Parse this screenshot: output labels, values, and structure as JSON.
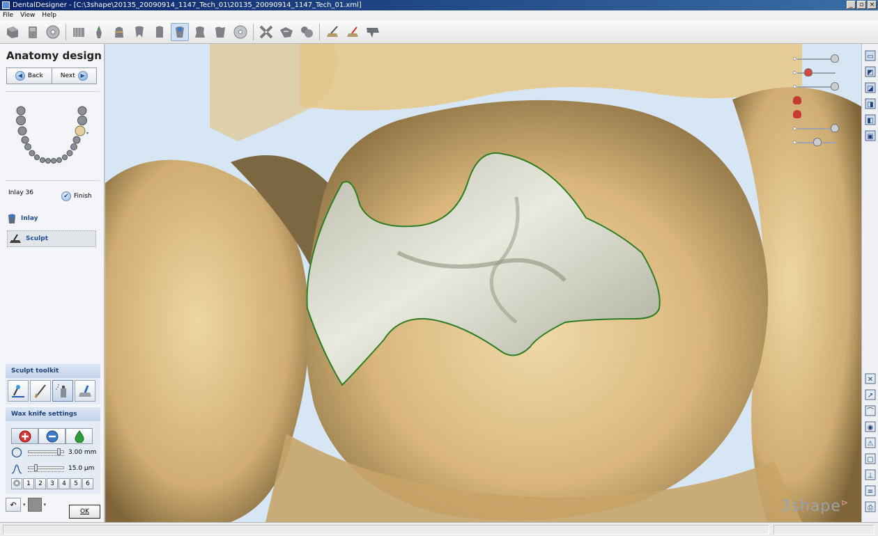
{
  "window": {
    "title": "DentalDesigner - [C:\\3shape\\20135_20090914_1147_Tech_01\\20135_20090914_1147_Tech_01.xml]",
    "minimize": "_",
    "restore": "▫",
    "close": "×"
  },
  "menu": [
    "File",
    "View",
    "Help"
  ],
  "toolbar": {
    "icons": [
      "order-icon",
      "scan-icon",
      "disc-icon",
      "model-icon",
      "margin-icon",
      "die-icon",
      "tooth-icon",
      "abutment-icon",
      "inlay-icon",
      "crown-icon",
      "bridge-icon",
      "cd-icon",
      "connect-icon",
      "connect2-icon",
      "cluster-icon",
      "sculpt-icon",
      "wax-icon",
      "export-icon"
    ],
    "active_index": 8
  },
  "left_panel": {
    "title": "Anatomy design",
    "back_label": "Back",
    "next_label": "Next",
    "tooth_label": "Inlay 36",
    "finish_label": "Finish",
    "steps": [
      {
        "label": "Inlay",
        "icon": "inlay-step-icon"
      },
      {
        "label": "Sculpt",
        "icon": "sculpt-step-icon",
        "active": true
      }
    ],
    "sculpt_toolkit": {
      "title": "Sculpt toolkit",
      "tools": [
        "wax-knife-tool-icon",
        "morph-pen-tool-icon",
        "spray-tool-icon",
        "smooth-tool-icon"
      ],
      "active_index": 2
    },
    "wax_knife": {
      "title": "Wax knife settings",
      "modes": [
        "add-icon",
        "remove-icon",
        "smooth-drop-icon"
      ],
      "active_mode": 0,
      "size_value": "3.00 mm",
      "size_level": 0.9,
      "amount_value": "15.0 µm",
      "amount_level": 0.2,
      "presets": [
        "1",
        "2",
        "3",
        "4",
        "5",
        "6"
      ]
    },
    "ok_label": "OK"
  },
  "viewport": {
    "logo": "3shape",
    "colors": {
      "background": "#d6e6f5",
      "tooth": "#e2c48e",
      "inlay": "#d6d7c9",
      "margin_line": "#2e7d22"
    },
    "sliders": [
      {
        "icon": "crown-visibility-icon",
        "level": 0.95
      },
      {
        "icon": "scissors-icon",
        "level": 0.2
      },
      {
        "icon": "tooth-visibility-icon",
        "level": 0.95
      },
      {
        "icon": "red-tooth-icon",
        "level": null
      },
      {
        "icon": "red-tooth2-icon",
        "level": null
      },
      {
        "icon": "crown2-visibility-icon",
        "level": 0.95
      },
      {
        "icon": "knob-icon",
        "level": 0.45
      }
    ]
  },
  "right_toolbar": {
    "top_icons": [
      "view-front-icon",
      "view-back-icon",
      "view-left-icon",
      "view-right-icon",
      "view-top-icon",
      "view-bottom-icon"
    ],
    "bottom_icons": [
      "fit-icon",
      "measure-icon",
      "clip-icon",
      "eye-icon",
      "warning-icon",
      "section-icon",
      "axis-icon",
      "note-icon",
      "print-icon"
    ]
  }
}
